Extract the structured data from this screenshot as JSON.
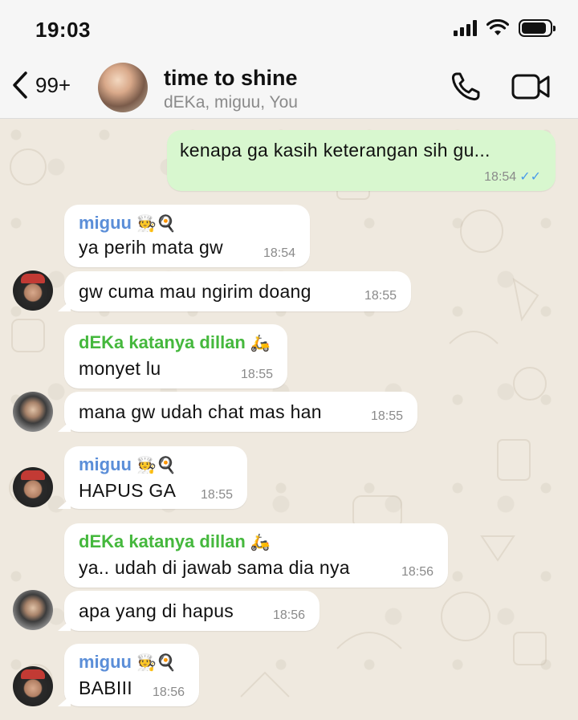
{
  "status": {
    "time": "19:03"
  },
  "header": {
    "back_count": "99+",
    "title": "time to shine",
    "members": "dEKa, miguu, You"
  },
  "messages": [
    {
      "sender": "",
      "text": "kenapa ga kasih keterangan sih gu...",
      "time": "18:54",
      "direction": "out"
    },
    {
      "sender": "miguu",
      "emoji": "🧑‍🍳🍳",
      "text": "ya perih mata gw",
      "time": "18:54",
      "direction": "in"
    },
    {
      "sender": "",
      "text": "gw cuma mau ngirim doang",
      "time": "18:55",
      "direction": "in"
    },
    {
      "sender": "dEKa katanya dillan",
      "emoji": "🛵",
      "text": "monyet lu",
      "time": "18:55",
      "direction": "in"
    },
    {
      "sender": "",
      "text": "mana gw udah chat mas han",
      "time": "18:55",
      "direction": "in"
    },
    {
      "sender": "miguu",
      "emoji": "🧑‍🍳🍳",
      "text": "HAPUS GA",
      "time": "18:55",
      "direction": "in"
    },
    {
      "sender": "dEKa katanya dillan",
      "emoji": "🛵",
      "text": "ya.. udah di jawab sama dia nya",
      "time": "18:56",
      "direction": "in"
    },
    {
      "sender": "",
      "text": "apa yang di hapus",
      "time": "18:56",
      "direction": "in"
    },
    {
      "sender": "miguu",
      "emoji": "🧑‍🍳🍳",
      "text": "BABIII",
      "time": "18:56",
      "direction": "in"
    }
  ],
  "colors": {
    "outgoing_bubble": "#d8f7cf",
    "miguu_name": "#5b8ed8",
    "deka_name": "#45b83d",
    "read_ticks": "#4a9bea"
  },
  "icons": [
    "back-chevron-icon",
    "phone-icon",
    "video-camera-icon",
    "signal-icon",
    "wifi-icon",
    "battery-icon"
  ]
}
